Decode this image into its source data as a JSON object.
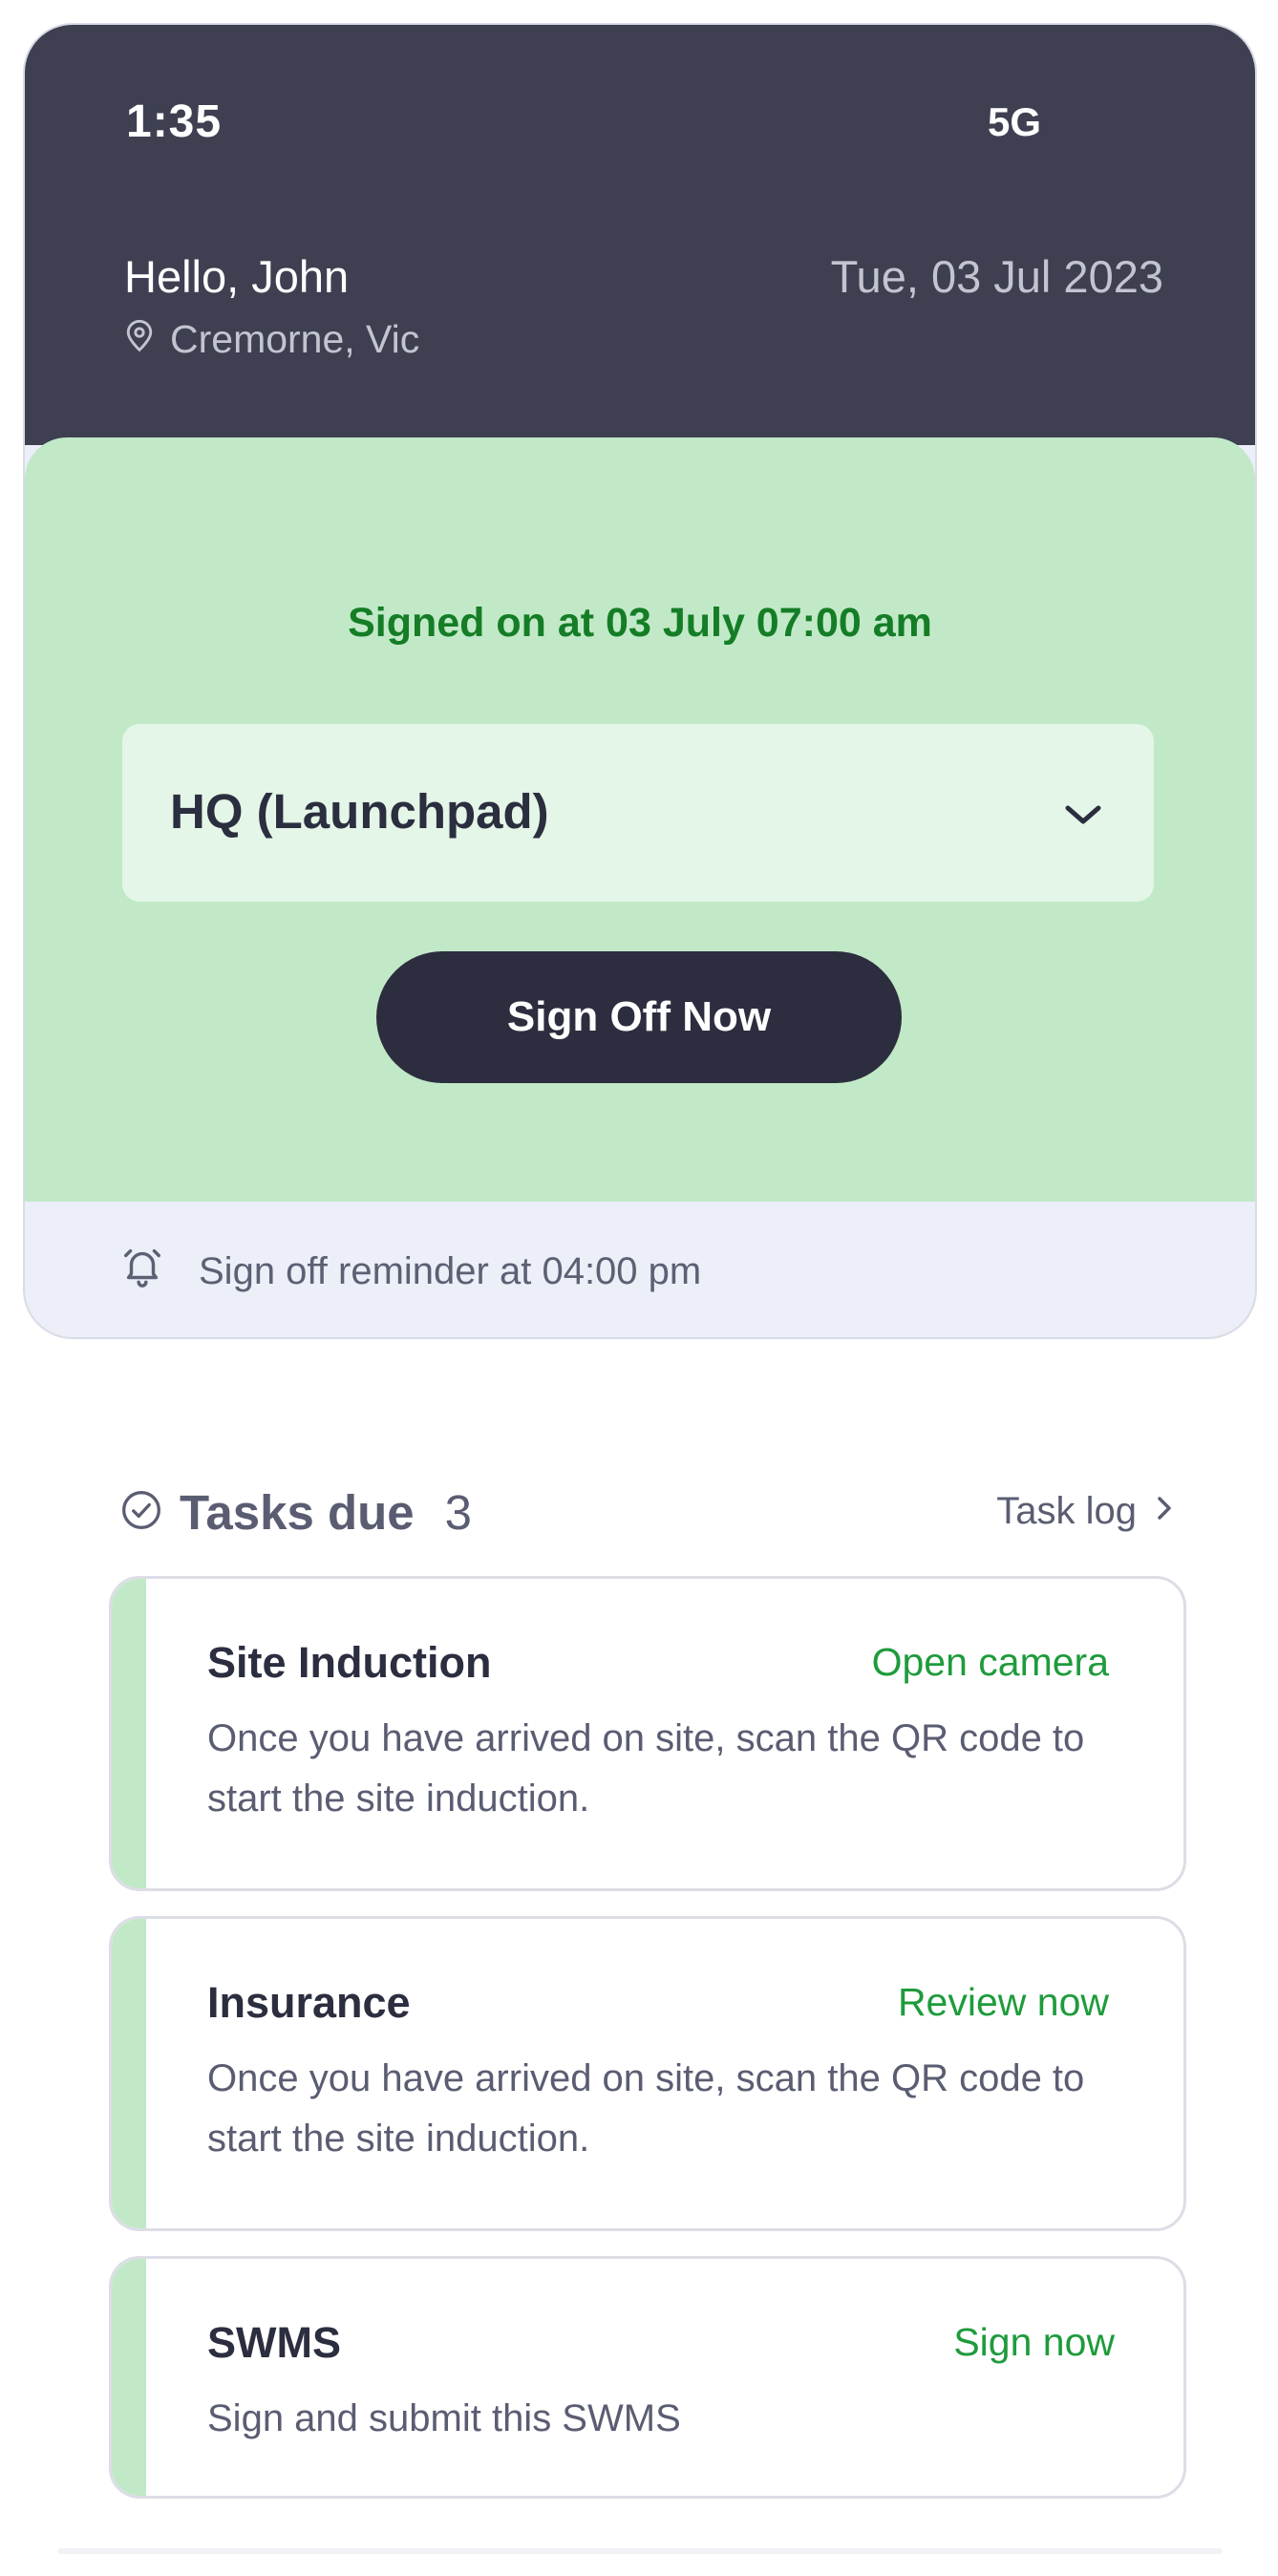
{
  "status_bar": {
    "time": "1:35",
    "network": "5G"
  },
  "header": {
    "greeting": "Hello, John",
    "date": "Tue, 03 Jul 2023",
    "location": "Cremorne, Vic",
    "location_icon": "map-pin-icon"
  },
  "sign_on": {
    "status": "Signed on at 03 July 07:00 am",
    "site_selected": "HQ (Launchpad)",
    "button_label": "Sign Off Now"
  },
  "reminder": {
    "text": "Sign off reminder at 04:00 pm",
    "icon": "bell-icon"
  },
  "tasks": {
    "title": "Tasks due",
    "count": "3",
    "log_label": "Task log",
    "items": [
      {
        "title": "Site Induction",
        "action": "Open camera",
        "description": "Once you have arrived on site, scan the QR code to start the site induction."
      },
      {
        "title": "Insurance",
        "action": "Review now",
        "description": "Once you have arrived on site, scan the QR code to start the site induction."
      },
      {
        "title": "SWMS",
        "action": "Sign now",
        "description": "Sign and submit this SWMS"
      }
    ]
  },
  "colors": {
    "header_bg": "#3e4052",
    "green_panel": "#c1e9c7",
    "signed_text": "#147d26",
    "action_text": "#1e9b3c",
    "button_bg": "#2c2e3f"
  }
}
